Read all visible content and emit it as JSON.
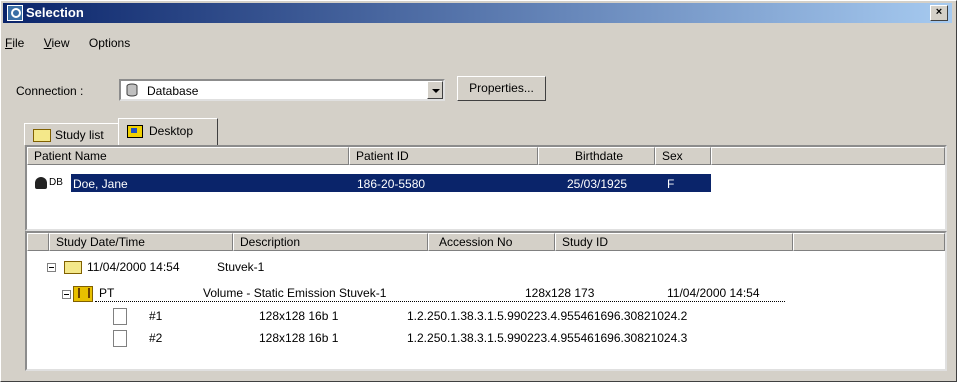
{
  "window": {
    "title": "Selection",
    "close": "×"
  },
  "menu": [
    {
      "mnemonic": "F",
      "rest": "ile"
    },
    {
      "mnemonic": "V",
      "rest": "iew"
    },
    {
      "mnemonic": "",
      "rest": "Options"
    }
  ],
  "connection": {
    "label": "Connection :",
    "value": "Database",
    "properties_label": "Properties..."
  },
  "tabs": [
    {
      "label": "Study list"
    },
    {
      "label": "Desktop",
      "active": true
    }
  ],
  "patients": {
    "columns": [
      "Patient Name",
      "Patient ID",
      "Birthdate",
      "Sex"
    ],
    "rows": [
      {
        "source": "DB",
        "name": "Doe, Jane",
        "id": "186-20-5580",
        "birthdate": "25/03/1925",
        "sex": "F",
        "selected": true
      }
    ]
  },
  "studies": {
    "columns": [
      "Study Date/Time",
      "Description",
      "Accession No",
      "Study ID"
    ],
    "study": {
      "datetime": "11/04/2000 14:54",
      "description": "Stuvek-1"
    },
    "series": {
      "modality": "PT",
      "description": "Volume - Static Emission Stuvek-1",
      "dims": "128x128 173",
      "datetime": "11/04/2000 14:54"
    },
    "images": [
      {
        "num": "#1",
        "format": "128x128 16b 1",
        "uid": "1.2.250.1.38.3.1.5.990223.4.955461696.30821024.2"
      },
      {
        "num": "#2",
        "format": "128x128 16b 1",
        "uid": "1.2.250.1.38.3.1.5.990223.4.955461696.30821024.3"
      }
    ]
  },
  "colors": {
    "titlebar": "#0a246a",
    "selection": "#0a246a",
    "face": "#d4d0c8"
  }
}
